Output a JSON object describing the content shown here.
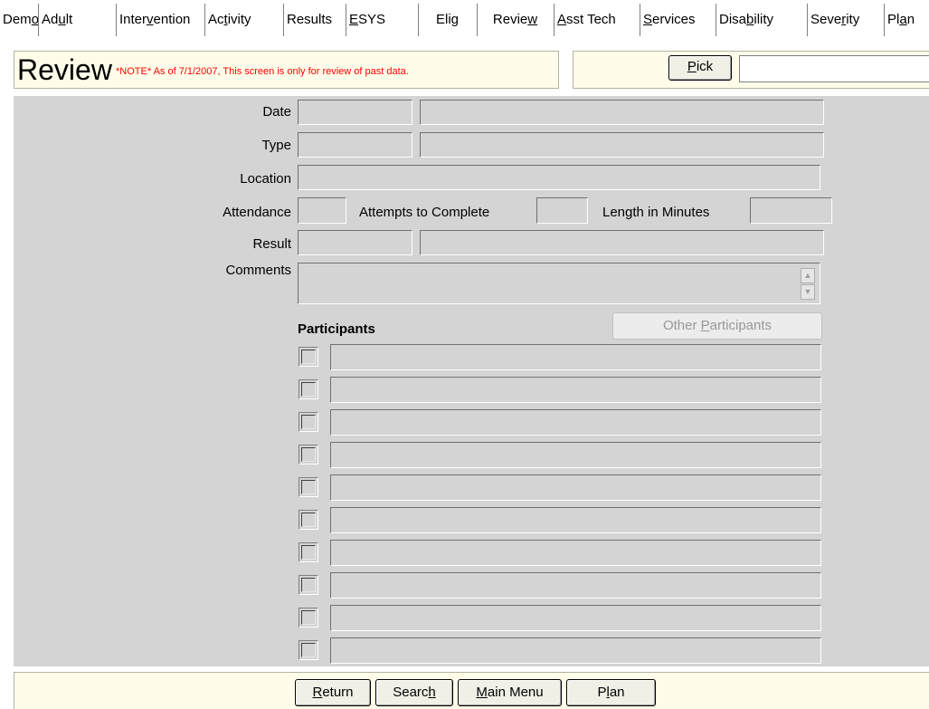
{
  "tabs": [
    {
      "pre": "Dem",
      "key": "o",
      "post": ""
    },
    {
      "pre": "Ad",
      "key": "u",
      "post": "lt"
    },
    {
      "pre": "Inter",
      "key": "v",
      "post": "ention"
    },
    {
      "pre": "Ac",
      "key": "t",
      "post": "ivity"
    },
    {
      "pre": "Results",
      "key": "",
      "post": ""
    },
    {
      "pre": "",
      "key": "E",
      "post": "SYS"
    },
    {
      "pre": "Eli",
      "key": "g",
      "post": ""
    },
    {
      "pre": "Revie",
      "key": "w",
      "post": ""
    },
    {
      "pre": "",
      "key": "A",
      "post": "sst Tech"
    },
    {
      "pre": "",
      "key": "S",
      "post": "ervices"
    },
    {
      "pre": "Disa",
      "key": "b",
      "post": "ility"
    },
    {
      "pre": "Seve",
      "key": "r",
      "post": "ity"
    },
    {
      "pre": "Pl",
      "key": "a",
      "post": "n"
    }
  ],
  "header": {
    "title": "Review",
    "note": "*NOTE* As of 7/1/2007, This screen is only for review of past data.",
    "pick_button": {
      "pre": "",
      "key": "P",
      "post": "ick"
    },
    "pick_value": ""
  },
  "form": {
    "date_label": "Date",
    "type_label": "Type",
    "location_label": "Location",
    "attendance_label": "Attendance",
    "attempts_label": "Attempts to Complete",
    "length_label": "Length in Minutes",
    "result_label": "Result",
    "comments_label": "Comments",
    "participants_label": "Participants",
    "other_participants_button": {
      "pre": "Other ",
      "key": "P",
      "post": "articipants"
    },
    "participant_rows": 10
  },
  "icons": {
    "scroll_up": "scroll-up-arrow-icon",
    "scroll_down": "scroll-down-arrow-icon"
  },
  "footer": {
    "buttons": [
      {
        "pre": "",
        "key": "R",
        "post": "eturn"
      },
      {
        "pre": "Searc",
        "key": "h",
        "post": ""
      },
      {
        "pre": "",
        "key": "M",
        "post": "ain Menu"
      },
      {
        "pre": "P",
        "key": "l",
        "post": "an"
      }
    ]
  }
}
